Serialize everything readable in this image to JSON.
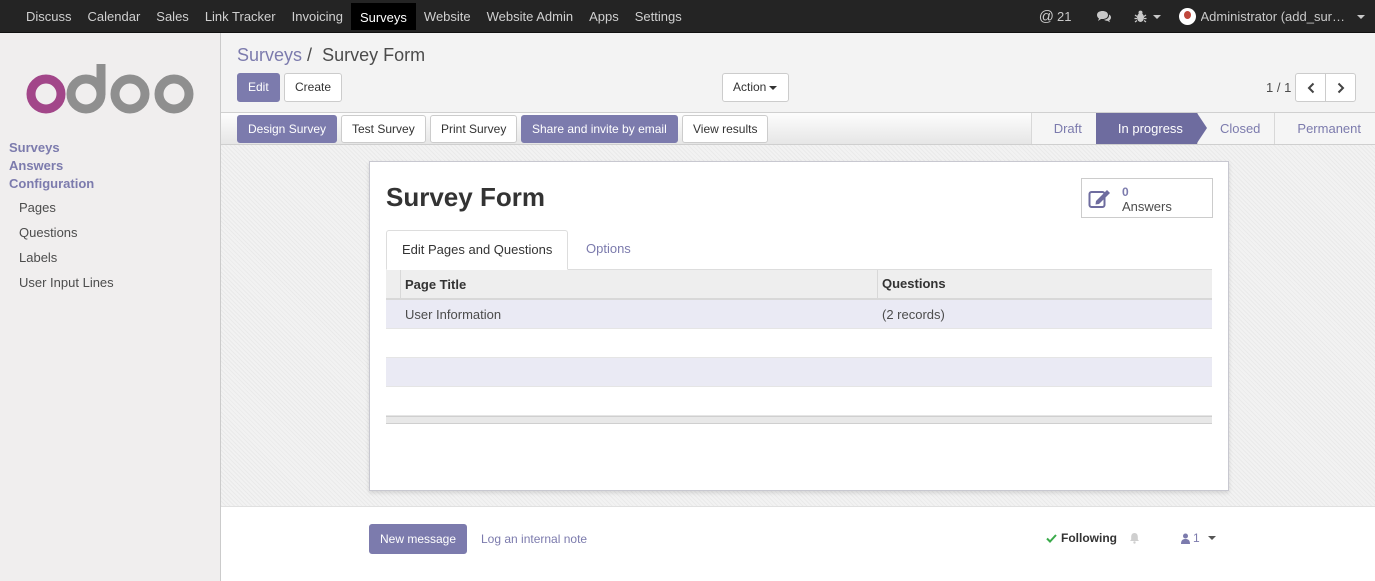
{
  "topbar": {
    "menu": [
      "Discuss",
      "Calendar",
      "Sales",
      "Link Tracker",
      "Invoicing",
      "Surveys",
      "Website",
      "Website Admin",
      "Apps",
      "Settings"
    ],
    "active_menu": "Surveys",
    "mentions_count": "21",
    "user_label": "Administrator (add_sur…"
  },
  "sidebar": {
    "sections": [
      "Surveys",
      "Answers",
      "Configuration"
    ],
    "items": [
      "Pages",
      "Questions",
      "Labels",
      "User Input Lines"
    ]
  },
  "breadcrumb": {
    "parent": "Surveys",
    "separator": "/",
    "current": "Survey Form"
  },
  "toolbar": {
    "edit": "Edit",
    "create": "Create",
    "action": "Action"
  },
  "pager": {
    "value": "1 / 1"
  },
  "statusbar": {
    "buttons": [
      "Design Survey",
      "Test Survey",
      "Print Survey",
      "Share and invite by email",
      "View results"
    ],
    "stages": [
      "Draft",
      "In progress",
      "Closed",
      "Permanent"
    ],
    "active_stage": "In progress"
  },
  "form": {
    "title": "Survey Form",
    "stat_button": {
      "value": "0",
      "label": "Answers"
    },
    "tabs": [
      "Edit Pages and Questions",
      "Options"
    ],
    "table": {
      "headers": [
        "Page Title",
        "Questions"
      ],
      "rows": [
        {
          "page_title": "User Information",
          "questions": "(2 records)"
        }
      ]
    }
  },
  "chatter": {
    "new_message": "New message",
    "log_note": "Log an internal note",
    "following": "Following",
    "followers_count": "1"
  },
  "colors": {
    "brand": "#7c7bad",
    "topbar": "#242424",
    "active_stage": "#6e6c9f"
  }
}
